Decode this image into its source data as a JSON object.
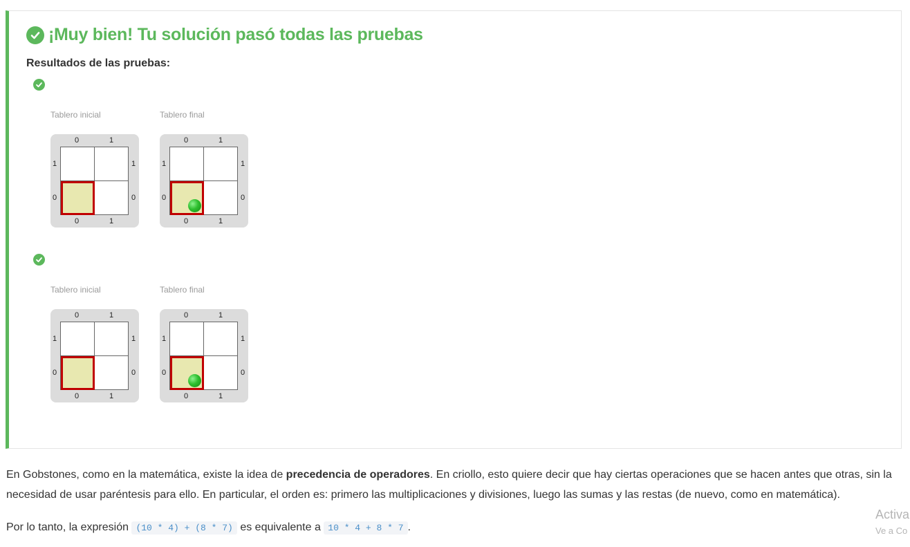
{
  "result": {
    "title": "¡Muy bien! Tu solución pasó todas las pruebas",
    "results_label": "Resultados de las pruebas:",
    "status_color": "#5cb85c",
    "tests": [
      {
        "status": "passed",
        "initial_caption": "Tablero inicial",
        "final_caption": "Tablero final",
        "initial_board": {
          "columns": [
            "0",
            "1"
          ],
          "rows": [
            "1",
            "0"
          ],
          "head": "0,0",
          "balls": []
        },
        "final_board": {
          "columns": [
            "0",
            "1"
          ],
          "rows": [
            "1",
            "0"
          ],
          "head": "0,0",
          "balls": [
            {
              "cell": "0,0",
              "color": "green",
              "count": "1"
            }
          ]
        }
      },
      {
        "status": "passed",
        "initial_caption": "Tablero inicial",
        "final_caption": "Tablero final",
        "initial_board": {
          "columns": [
            "0",
            "1"
          ],
          "rows": [
            "1",
            "0"
          ],
          "head": "0,0",
          "balls": []
        },
        "final_board": {
          "columns": [
            "0",
            "1"
          ],
          "rows": [
            "1",
            "0"
          ],
          "head": "0,0",
          "balls": [
            {
              "cell": "0,0",
              "color": "green",
              "count": "1"
            }
          ]
        }
      }
    ]
  },
  "explanation": {
    "p1_before": "En Gobstones, como en la matemática, existe la idea de ",
    "p1_bold": "precedencia de operadores",
    "p1_after": ". En criollo, esto quiere decir que hay ciertas operaciones que se hacen antes que otras, sin la necesidad de usar paréntesis para ello. En particular, el orden es: primero las multiplicaciones y divisiones, luego las sumas y las restas (de nuevo, como en matemática).",
    "p2_before": "Por lo tanto, la expresión ",
    "p2_code1": "(10 * 4) + (8 * 7)",
    "p2_middle": " es equivalente a ",
    "p2_code2": "10 * 4 + 8 * 7",
    "p2_after": "."
  },
  "watermark": {
    "line1": "Activa",
    "line2": "Ve a Co"
  }
}
